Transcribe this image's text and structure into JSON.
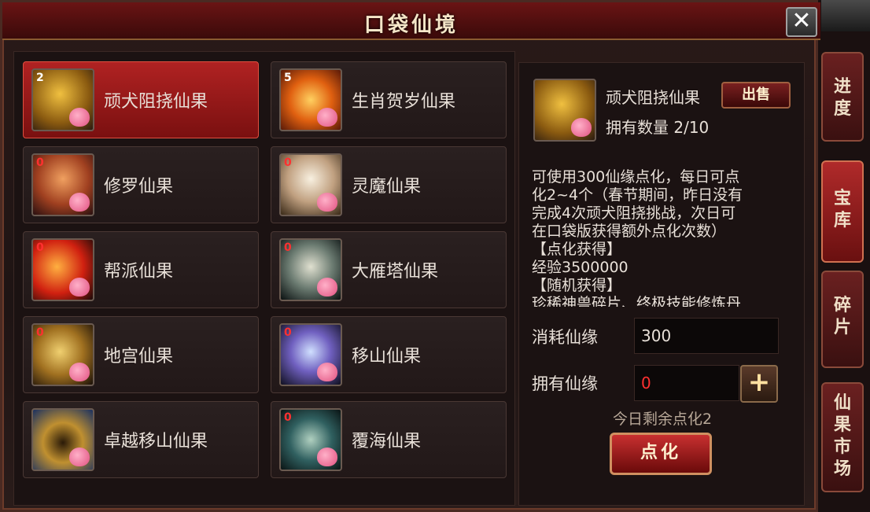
{
  "title": "口袋仙境",
  "close_icon": "close-icon",
  "items": [
    {
      "name": "顽犬阻挠仙果",
      "count": "2",
      "selected": true,
      "icon": "golden-lion-icon"
    },
    {
      "name": "生肖贺岁仙果",
      "count": "5",
      "selected": false,
      "icon": "fire-fist-icon"
    },
    {
      "name": "修罗仙果",
      "count": "0",
      "selected": false,
      "icon": "asura-icon"
    },
    {
      "name": "灵魔仙果",
      "count": "0",
      "selected": false,
      "icon": "hooded-hero-icon"
    },
    {
      "name": "帮派仙果",
      "count": "0",
      "selected": false,
      "icon": "gang-banner-icon"
    },
    {
      "name": "大雁塔仙果",
      "count": "0",
      "selected": false,
      "icon": "pagoda-icon"
    },
    {
      "name": "地宫仙果",
      "count": "0",
      "selected": false,
      "icon": "token-icon"
    },
    {
      "name": "移山仙果",
      "count": "0",
      "selected": false,
      "icon": "crystal-icon"
    },
    {
      "name": "卓越移山仙果",
      "count": "",
      "selected": false,
      "icon": "golden-cave-icon"
    },
    {
      "name": "覆海仙果",
      "count": "0",
      "selected": false,
      "icon": "dragon-boat-icon"
    }
  ],
  "detail": {
    "name": "顽犬阻挠仙果",
    "sell_label": "出售",
    "qty_text": "拥有数量 2/10",
    "description": [
      "可使用300仙缘点化，每日可点",
      "化2~4个（春节期间，昨日没有",
      "完成4次顽犬阻挠挑战，次日可",
      "在口袋版获得额外点化次数）",
      "【点化获得】",
      "经验3500000",
      "【随机获得】",
      "珍稀神兽碎片、终极技能修炼丹"
    ],
    "cost_label": "消耗仙缘",
    "cost_value": "300",
    "own_label": "拥有仙缘",
    "own_value": "0",
    "remain_text": "今日剩余点化2",
    "refine_label": "点化"
  },
  "side_tabs": [
    {
      "label": "进度",
      "active": false
    },
    {
      "label": "宝库",
      "active": true
    },
    {
      "label": "碎片",
      "active": false
    },
    {
      "label": "仙果市场",
      "active": false
    }
  ]
}
